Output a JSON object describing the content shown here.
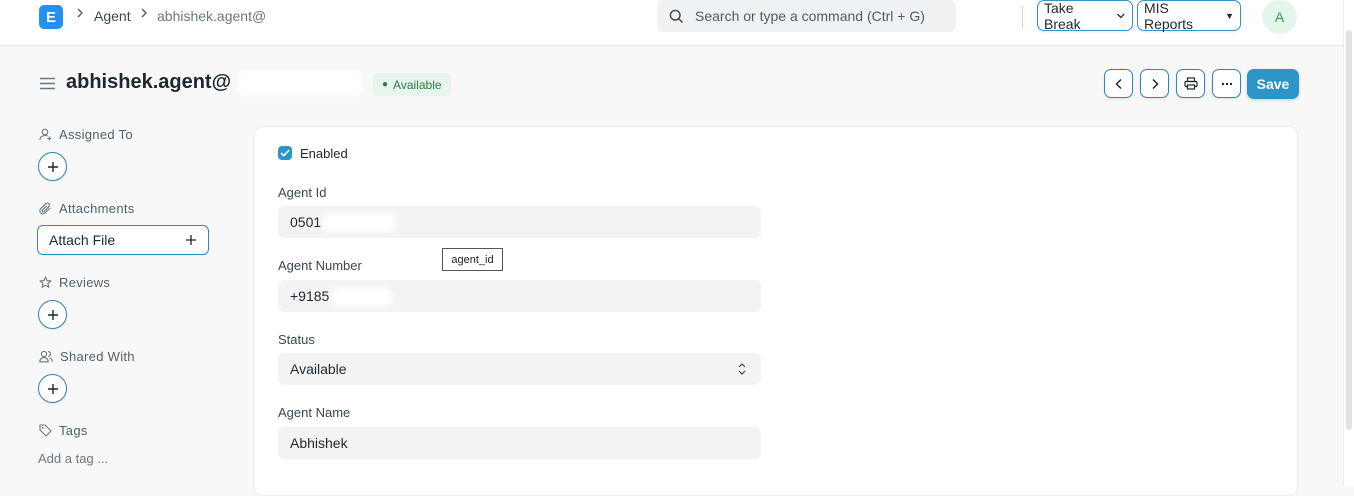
{
  "navbar": {
    "logo_letter": "E",
    "breadcrumbs": [
      "Agent",
      "abhishek.agent@"
    ],
    "search_placeholder": "Search or type a command (Ctrl + G)",
    "take_break_label": "Take Break",
    "mis_reports_label": "MIS Reports",
    "avatar_letter": "A"
  },
  "header": {
    "title": "abhishek.agent@",
    "status_badge": "Available",
    "save_label": "Save"
  },
  "sidebar": {
    "assigned_to": "Assigned To",
    "attachments": "Attachments",
    "attach_file": "Attach File",
    "reviews": "Reviews",
    "shared_with": "Shared With",
    "tags": "Tags",
    "add_tag": "Add a tag ..."
  },
  "form": {
    "enabled_label": "Enabled",
    "enabled_checked": true,
    "agent_id_label": "Agent Id",
    "agent_id_value": "0501",
    "agent_number_label": "Agent Number",
    "agent_number_value": "+9185",
    "status_label": "Status",
    "status_value": "Available",
    "agent_name_label": "Agent Name",
    "agent_name_value": "Abhishek"
  },
  "tooltip": {
    "text": "agent_id"
  },
  "colors": {
    "primary": "#2b95c7",
    "accent_border": "#2f86b9",
    "logo": "#2490ef",
    "badge_bg": "#e8f5ec",
    "badge_text": "#2f7a48"
  }
}
